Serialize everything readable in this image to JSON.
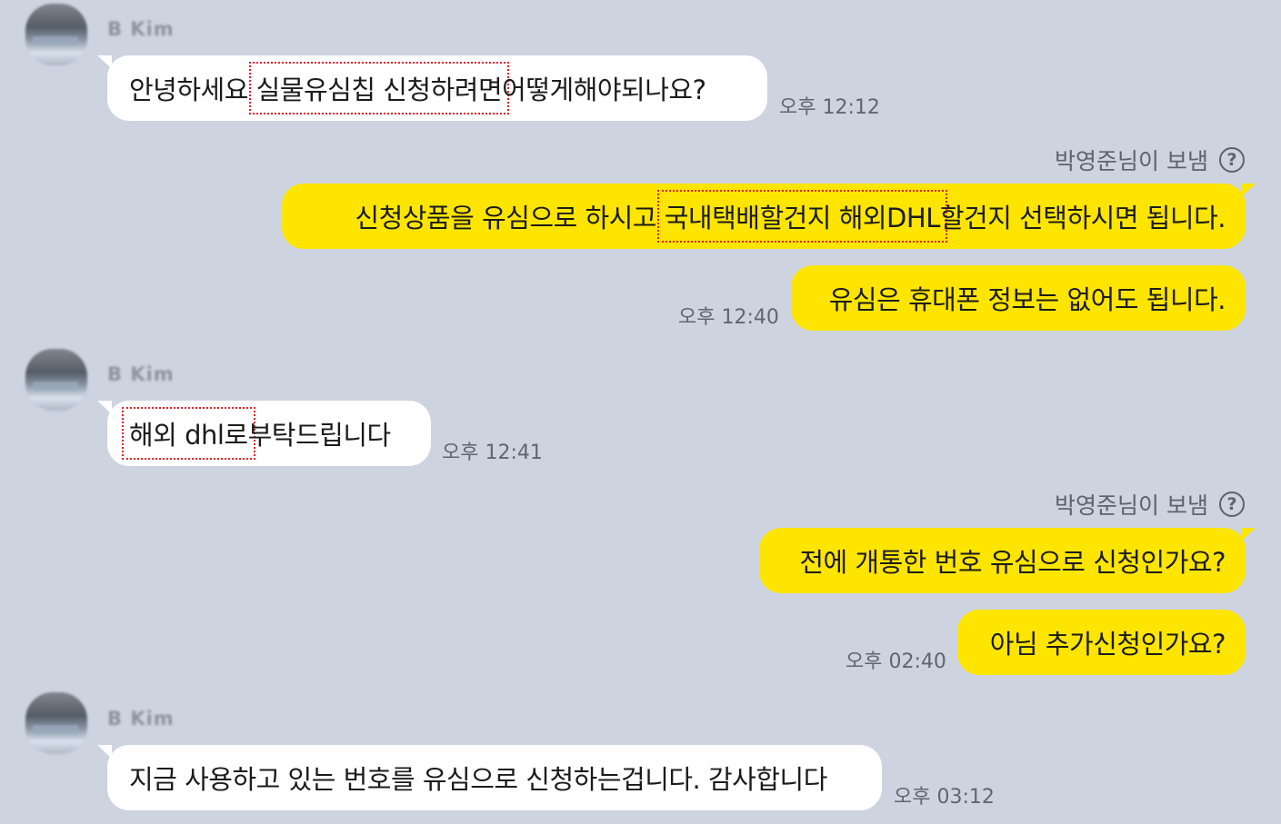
{
  "messages": {
    "m1": {
      "sender": "B Kim",
      "pre": "안녕하세요 ",
      "highlight": "실물유심칩 신청하려면",
      "post": "어떻게해야되나요?",
      "time": "오후 12:12"
    },
    "m2": {
      "sent_by": "박영준님이 보냄",
      "help_icon": "?",
      "pre": "신청상품을 유심으로 하시고 ",
      "highlight": "국내택배할건지 해외DHL",
      "post": "할건지 선택하시면 됩니다."
    },
    "m3": {
      "text": "유심은 휴대폰 정보는 없어도 됩니다.",
      "time": "오후 12:40"
    },
    "m4": {
      "sender": "B Kim",
      "highlight": "해외 dhl로",
      "post": "부탁드립니다",
      "time": "오후 12:41"
    },
    "m5": {
      "sent_by": "박영준님이 보냄",
      "help_icon": "?",
      "text": "전에 개통한 번호 유심으로 신청인가요?"
    },
    "m6": {
      "text": "아님 추가신청인가요?",
      "time": "오후 02:40"
    },
    "m7": {
      "sender": "B Kim",
      "text": "지금 사용하고 있는 번호를 유심으로 신청하는겁니다. 감사합니다",
      "time": "오후 03:12"
    }
  },
  "colors": {
    "background": "#cdd3df",
    "incoming_bubble": "#ffffff",
    "outgoing_bubble": "#fee500",
    "highlight_box": "#e0202a"
  },
  "icons": {
    "avatar": "profile-photo-blurred",
    "help": "question-circle-icon"
  }
}
